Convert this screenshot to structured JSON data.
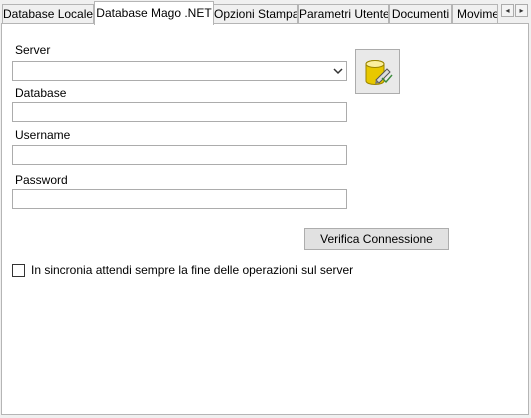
{
  "tabs": [
    {
      "label": "Database Locale",
      "active": false
    },
    {
      "label": "Database Mago .NET",
      "active": true
    },
    {
      "label": "Opzioni Stampa",
      "active": false
    },
    {
      "label": "Parametri Utente",
      "active": false
    },
    {
      "label": "Documenti",
      "active": false
    },
    {
      "label": "Movimer",
      "active": false
    }
  ],
  "tab_scroll": {
    "left_glyph": "◂",
    "right_glyph": "▸"
  },
  "form": {
    "server_label": "Server",
    "server_value": "",
    "database_label": "Database",
    "database_value": "",
    "username_label": "Username",
    "username_value": "",
    "password_label": "Password",
    "password_value": ""
  },
  "db_button_icon": "database-edit-icon",
  "verify_button_label": "Verifica Connessione",
  "sync_checkbox": {
    "label": "In sincronia attendi sempre la fine delle operazioni sul server",
    "checked": false
  },
  "colors": {
    "panel": "#ffffff",
    "window": "#f0f0f0",
    "border": "#b5b5b5",
    "db_yellow": "#e8c800"
  }
}
